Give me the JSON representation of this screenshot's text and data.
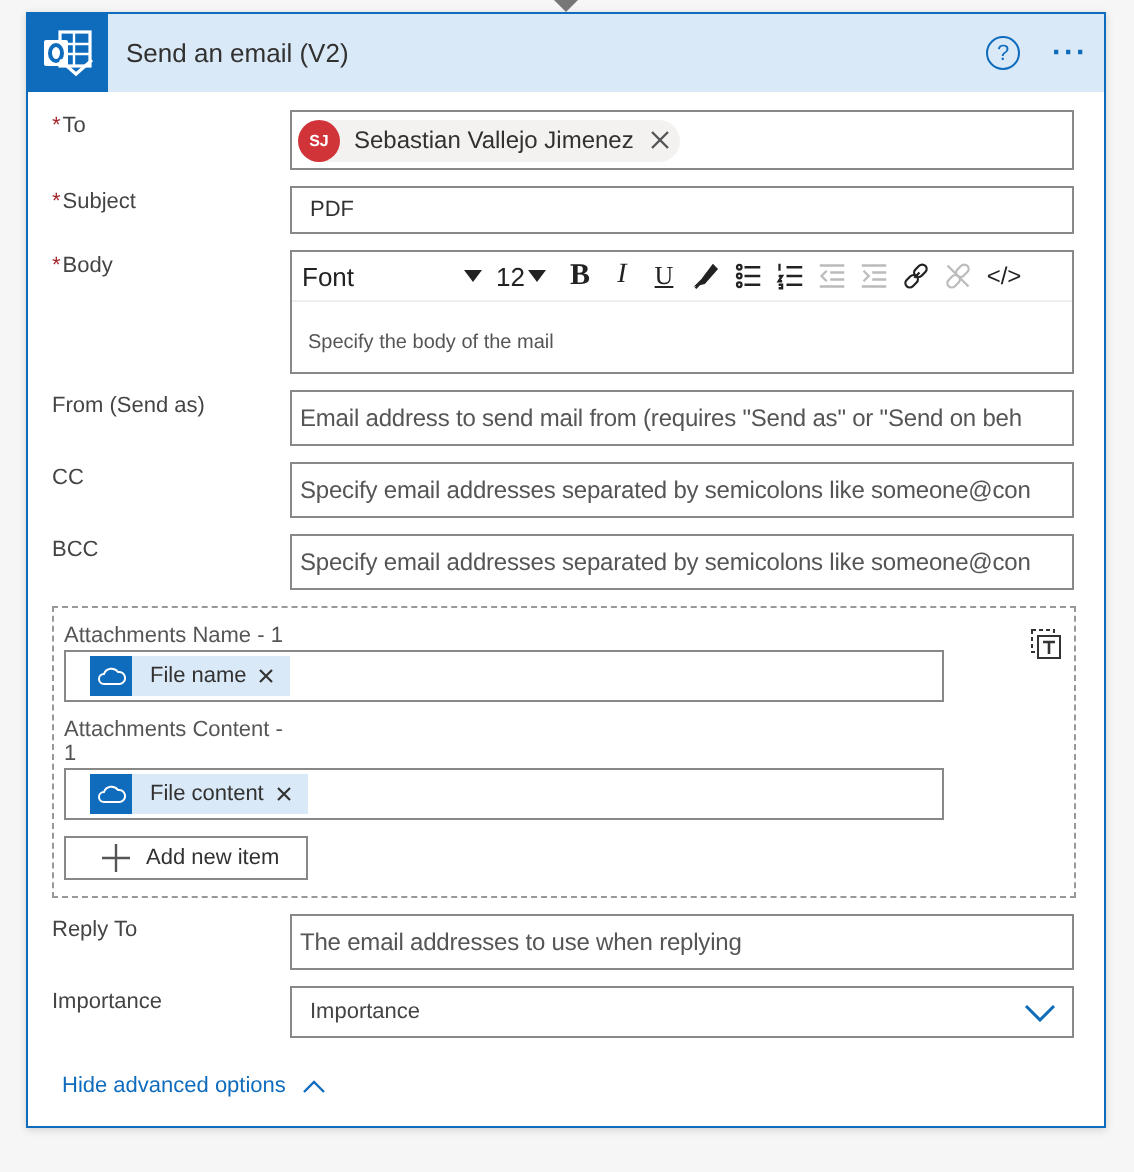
{
  "card": {
    "title": "Send an email (V2)",
    "help": "?",
    "more": "···"
  },
  "to": {
    "label": "To",
    "required_mark": "*",
    "recipients": [
      {
        "initials": "SJ",
        "name": "Sebastian Vallejo Jimenez",
        "color": "#d13438"
      }
    ]
  },
  "subject": {
    "label": "Subject",
    "required_mark": "*",
    "value": "PDF"
  },
  "body": {
    "label": "Body",
    "required_mark": "*",
    "font": "Font",
    "size": "12",
    "placeholder": "Specify the body of the mail",
    "tools": [
      {
        "kind": "bold",
        "label": "B",
        "disabled": false
      },
      {
        "kind": "italic",
        "label": "I",
        "disabled": false
      },
      {
        "kind": "underline",
        "label": "U",
        "disabled": false
      },
      {
        "kind": "highlight",
        "disabled": false
      },
      {
        "kind": "bullets",
        "disabled": false
      },
      {
        "kind": "numbering",
        "disabled": false
      },
      {
        "kind": "outdent",
        "disabled": true
      },
      {
        "kind": "indent",
        "disabled": true
      },
      {
        "kind": "link",
        "disabled": false
      },
      {
        "kind": "unlink",
        "disabled": true
      },
      {
        "kind": "code",
        "label": "</>",
        "disabled": false
      }
    ]
  },
  "fields": [
    {
      "label": "From (Send as)",
      "placeholder": "Email address to send mail from (requires \"Send as\" or \"Send on beh"
    },
    {
      "label": "CC",
      "placeholder": "Specify email addresses separated by semicolons like someone@con"
    },
    {
      "label": "BCC",
      "placeholder": "Specify email addresses separated by semicolons like someone@con"
    }
  ],
  "attachments": {
    "items": [
      {
        "label": "Attachments Name - 1",
        "token": "File name"
      },
      {
        "label": "Attachments Content - 1",
        "token": "File content"
      }
    ],
    "add": "Add new item"
  },
  "reply_to": {
    "label": "Reply To",
    "placeholder": "The email addresses to use when replying"
  },
  "importance": {
    "label": "Importance",
    "placeholder": "Importance"
  },
  "advanced": {
    "label": "Hide advanced options",
    "expanded": true
  }
}
